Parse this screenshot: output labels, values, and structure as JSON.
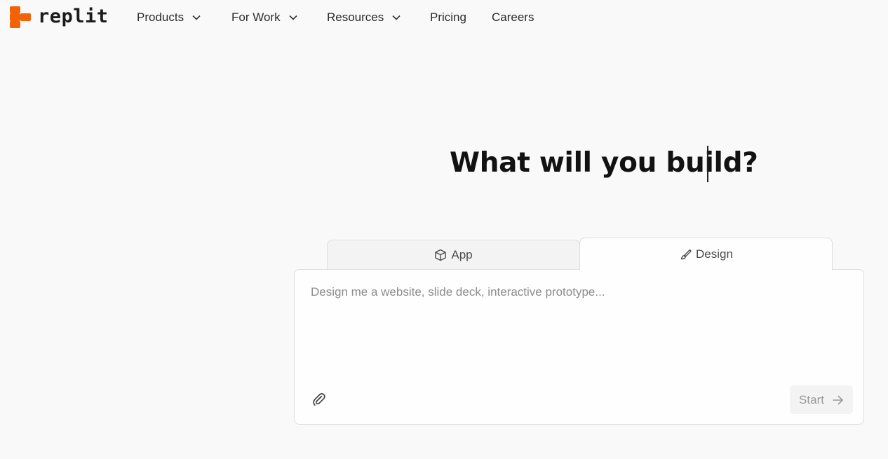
{
  "brand": {
    "name": "replit",
    "accent": "#f26207"
  },
  "nav": {
    "items": [
      {
        "label": "Products",
        "has_dropdown": true
      },
      {
        "label": "For Work",
        "has_dropdown": true
      },
      {
        "label": "Resources",
        "has_dropdown": true
      },
      {
        "label": "Pricing",
        "has_dropdown": false
      },
      {
        "label": "Careers",
        "has_dropdown": false
      }
    ]
  },
  "hero": {
    "headline": "What will you build?"
  },
  "tabs": [
    {
      "label": "App",
      "icon": "cube-icon",
      "active": false
    },
    {
      "label": "Design",
      "icon": "brush-icon",
      "active": true
    }
  ],
  "composer": {
    "placeholder": "Design me a website, slide deck, interactive prototype...",
    "value": "",
    "attach_icon": "paperclip-icon",
    "start_label": "Start",
    "start_icon": "arrow-right-icon"
  }
}
